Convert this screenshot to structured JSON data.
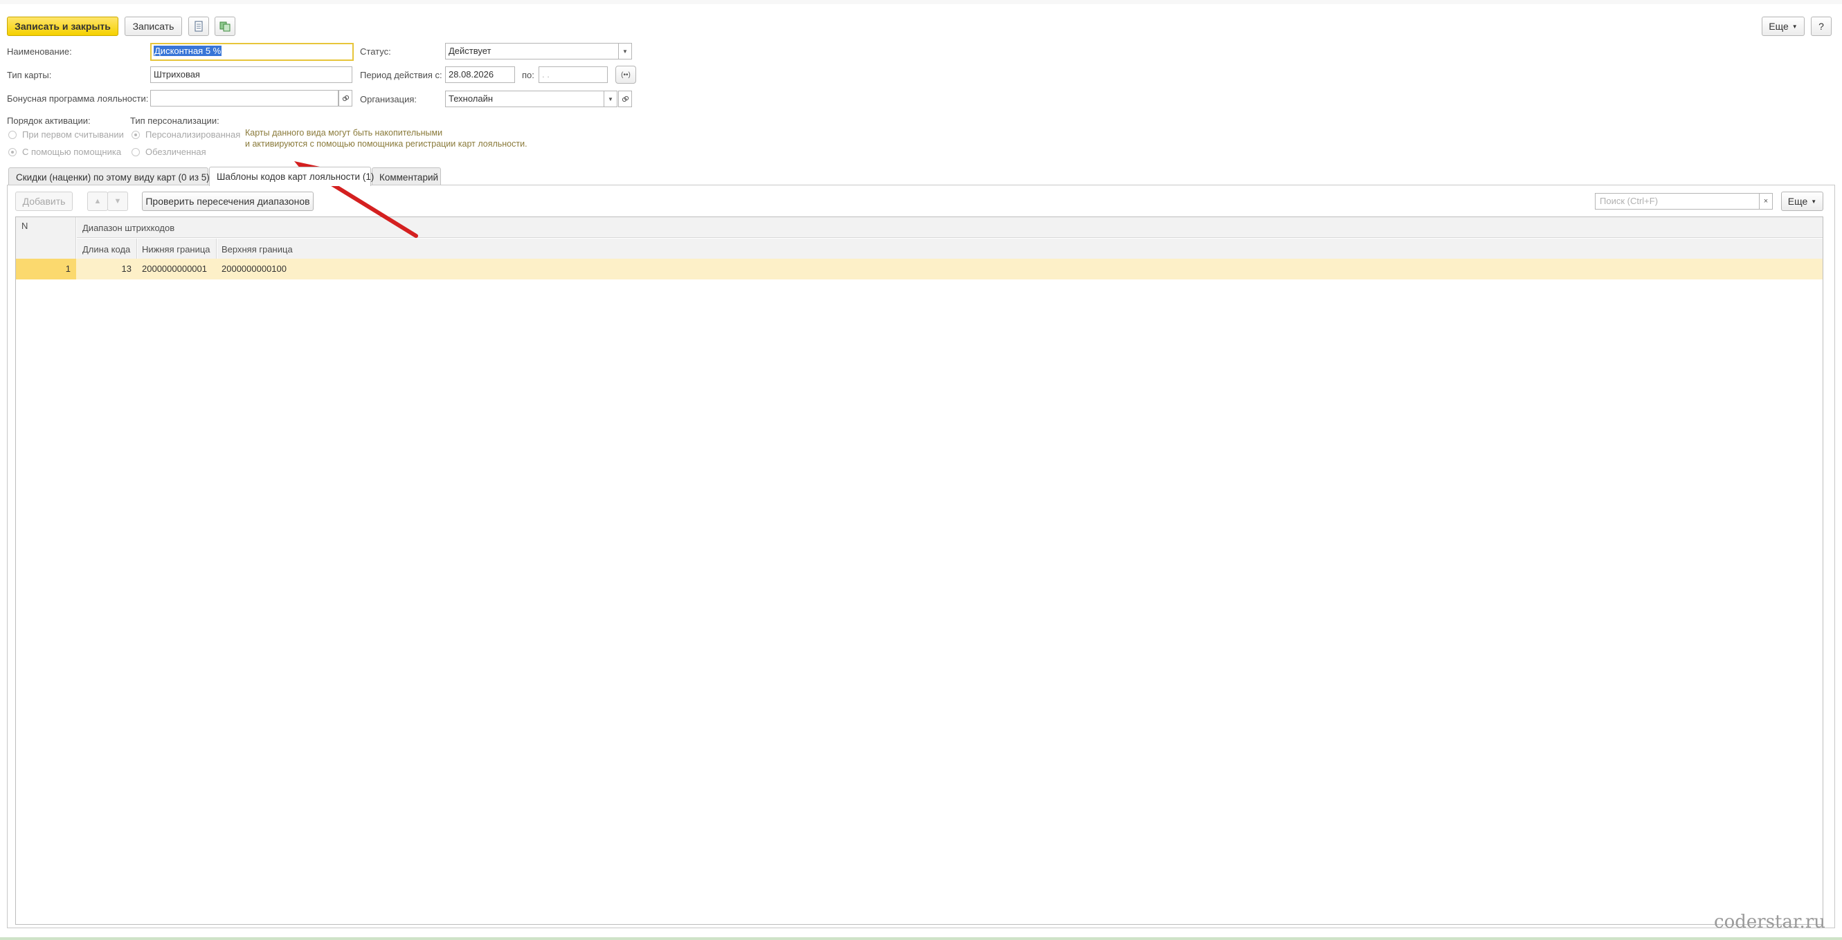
{
  "toolbar": {
    "save_close_label": "Записать и закрыть",
    "save_label": "Записать",
    "more_label": "Еще",
    "help_label": "?"
  },
  "form": {
    "name_label": "Наименование:",
    "name_value": "Дисконтная 5 %",
    "status_label": "Статус:",
    "status_value": "Действует",
    "card_type_label": "Тип карты:",
    "card_type_value": "Штриховая",
    "period_label": "Период действия с:",
    "period_from": "28.08.2026",
    "period_to_label": "по:",
    "period_to_placeholder": ". .",
    "bonus_label": "Бонусная программа лояльности:",
    "bonus_value": "",
    "org_label": "Организация:",
    "org_value": "Технолайн"
  },
  "activation": {
    "title": "Порядок активации:",
    "options": [
      "При первом считывании",
      "С помощью помощника"
    ]
  },
  "personalization": {
    "title": "Тип персонализации:",
    "options": [
      "Персонализированная",
      "Обезличенная"
    ]
  },
  "hint": {
    "line1": "Карты данного вида могут быть накопительными",
    "line2": "и активируются с помощью помощника регистрации карт лояльности."
  },
  "tabs": [
    {
      "label": "Скидки (наценки) по этому виду карт (0 из 5)"
    },
    {
      "label": "Шаблоны кодов карт лояльности (1)"
    },
    {
      "label": "Комментарий"
    }
  ],
  "table_toolbar": {
    "add_label": "Добавить",
    "check_label": "Проверить пересечения диапазонов",
    "search_placeholder": "Поиск (Ctrl+F)",
    "more_label": "Еще"
  },
  "table": {
    "col_n": "N",
    "group_header": "Диапазон штрихкодов",
    "col_length": "Длина кода",
    "col_lower": "Нижняя граница",
    "col_upper": "Верхняя граница",
    "rows": [
      {
        "n": "1",
        "length": "13",
        "lower": "2000000000001",
        "upper": "2000000000100"
      }
    ]
  },
  "watermark": "coderstar.ru",
  "colors": {
    "accent_yellow": "#f5d100",
    "row_highlight": "#fdf0c8",
    "arrow_red": "#d42020"
  }
}
